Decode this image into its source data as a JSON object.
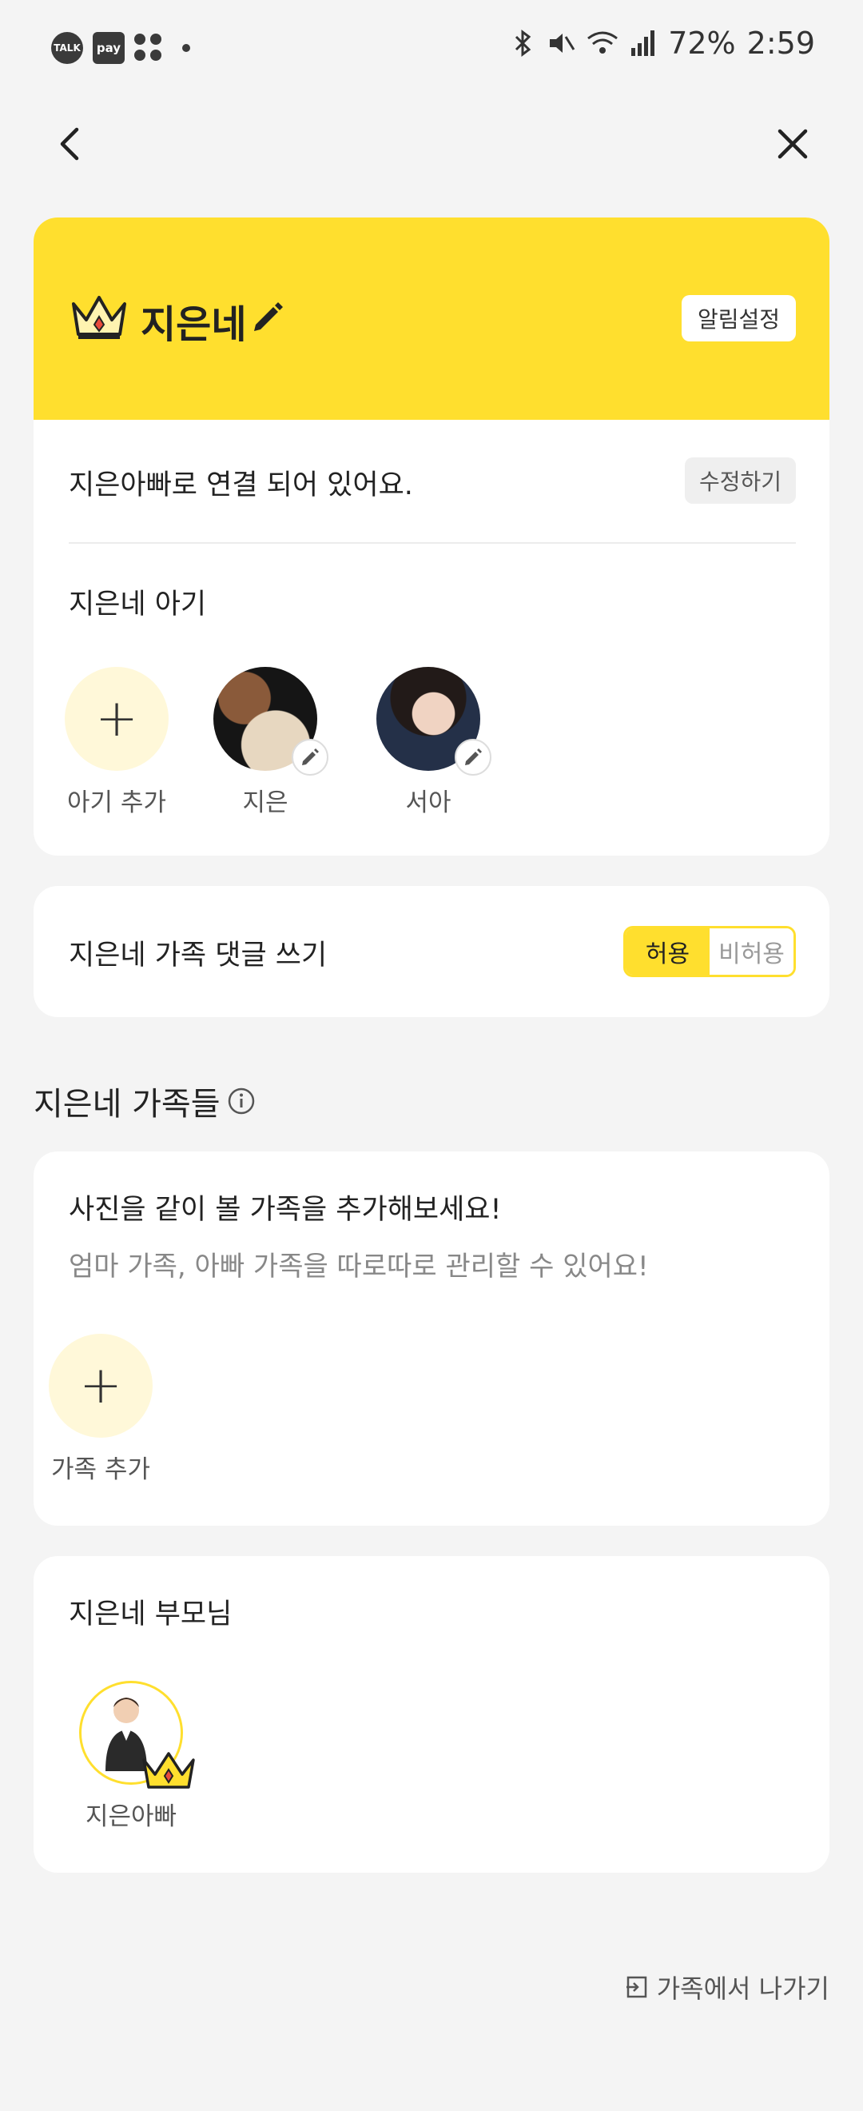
{
  "status_bar": {
    "talk_badge": "TALK",
    "pay_badge": "pay",
    "battery": "72%",
    "time": "2:59"
  },
  "family": {
    "name": "지은네",
    "notification_button": "알림설정",
    "link_status": "지은아빠로 연결 되어 있어요.",
    "edit_button": "수정하기",
    "babies_title": "지은네 아기",
    "babies": [
      {
        "label": "아기 추가"
      },
      {
        "label": "지은"
      },
      {
        "label": "서아"
      }
    ]
  },
  "comment": {
    "title": "지은네 가족 댓글 쓰기",
    "allow": "허용",
    "disallow": "비허용"
  },
  "families": {
    "heading": "지은네 가족들",
    "prompt_title": "사진을 같이 볼 가족을 추가해보세요!",
    "prompt_sub": "엄마 가족, 아빠 가족을 따로따로 관리할 수 있어요!",
    "add_label": "가족 추가"
  },
  "parents": {
    "title": "지은네 부모님",
    "members": [
      {
        "label": "지은아빠"
      }
    ]
  },
  "leave_button": "가족에서 나가기",
  "colors": {
    "accent": "#ffdf2e",
    "background": "#f4f4f4",
    "add_circle": "#fff8d9"
  }
}
